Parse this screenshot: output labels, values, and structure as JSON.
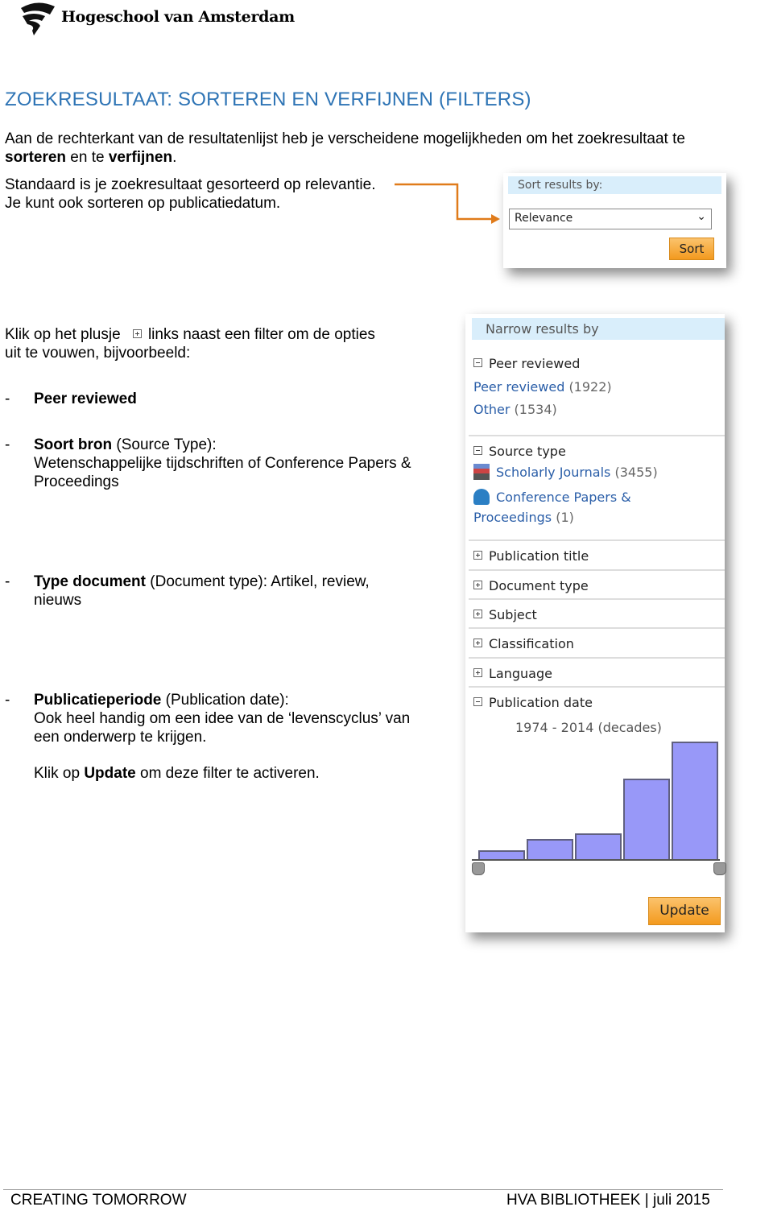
{
  "logo": {
    "name": "Hogeschool van Amsterdam"
  },
  "title": "ZOEKRESULTAAT: SORTEREN EN VERFIJNEN (FILTERS)",
  "intro": {
    "p1": "Aan de rechterkant van de resultatenlijst heb je verscheidene mogelijkheden om het zoekresultaat te",
    "p2a": "sorteren",
    "p2b": " en te ",
    "p2c": "verfijnen",
    "p2d": "."
  },
  "sort_text": {
    "l1": "Standaard is je zoekresultaat gesorteerd op relevantie.",
    "l2": "Je kunt ook sorteren op publicatiedatum."
  },
  "sort_box": {
    "label": "Sort results by:",
    "selected": "Relevance",
    "button": "Sort"
  },
  "filter_text": {
    "l1a": "Klik op het plusje",
    "l1b": "links naast een filter om de opties",
    "l2": "uit te vouwen, bijvoorbeeld:"
  },
  "bullets": [
    {
      "dash": "-",
      "bold": "Peer reviewed",
      "rest": "",
      "l2": "",
      "l3": ""
    },
    {
      "dash": "-",
      "bold": "Soort bron",
      "rest": " (Source Type):",
      "l2": "Wetenschappelijke tijdschriften of Conference Papers &",
      "l3": "Proceedings"
    },
    {
      "dash": "-",
      "bold": "Type document",
      "rest": " (Document type): Artikel, review,",
      "l2": "nieuws",
      "l3": ""
    },
    {
      "dash": "-",
      "bold": "Publicatieperiode",
      "rest": " (Publication date):",
      "l2": "Ook heel handig om een idee van de ‘levenscyclus’ van",
      "l3": "een onderwerp  te krijgen."
    }
  ],
  "update_note": {
    "a": "Klik op ",
    "b": "Update",
    "c": " om deze filter te activeren."
  },
  "narrow": {
    "header": "Narrow results by",
    "peer": {
      "label": "Peer reviewed",
      "items": [
        {
          "label": "Peer reviewed",
          "count": "(1922)"
        },
        {
          "label": "Other",
          "count": "(1534)"
        }
      ]
    },
    "source": {
      "label": "Source type",
      "items": [
        {
          "label": "Scholarly Journals",
          "count": "(3455)",
          "icon": "journal-icon"
        },
        {
          "label": "Conference Papers &",
          "label2": "Proceedings",
          "count": "(1)",
          "icon": "conference-icon"
        }
      ]
    },
    "collapsed": [
      "Publication title",
      "Document type",
      "Subject",
      "Classification",
      "Language"
    ],
    "pubdate": {
      "label": "Publication date",
      "range": "1974 - 2014 (decades)"
    },
    "update": "Update"
  },
  "chart_data": {
    "type": "bar",
    "title": "1974 - 2014 (decades)",
    "values": [
      11,
      25,
      32,
      99,
      145
    ],
    "note": "relative bar heights, unlabeled"
  },
  "colors": {
    "accent": "#2e74b5",
    "link": "#2a5ea8",
    "button": "#f39a1e",
    "bar": "#9898f8",
    "header": "#d9eefb",
    "arrow": "#e07b1a"
  },
  "footer": {
    "left": "CREATING TOMORROW",
    "right_a": "HVA BIBLIOTHEEK",
    "sep": "|",
    "right_b": "juli 2015"
  }
}
